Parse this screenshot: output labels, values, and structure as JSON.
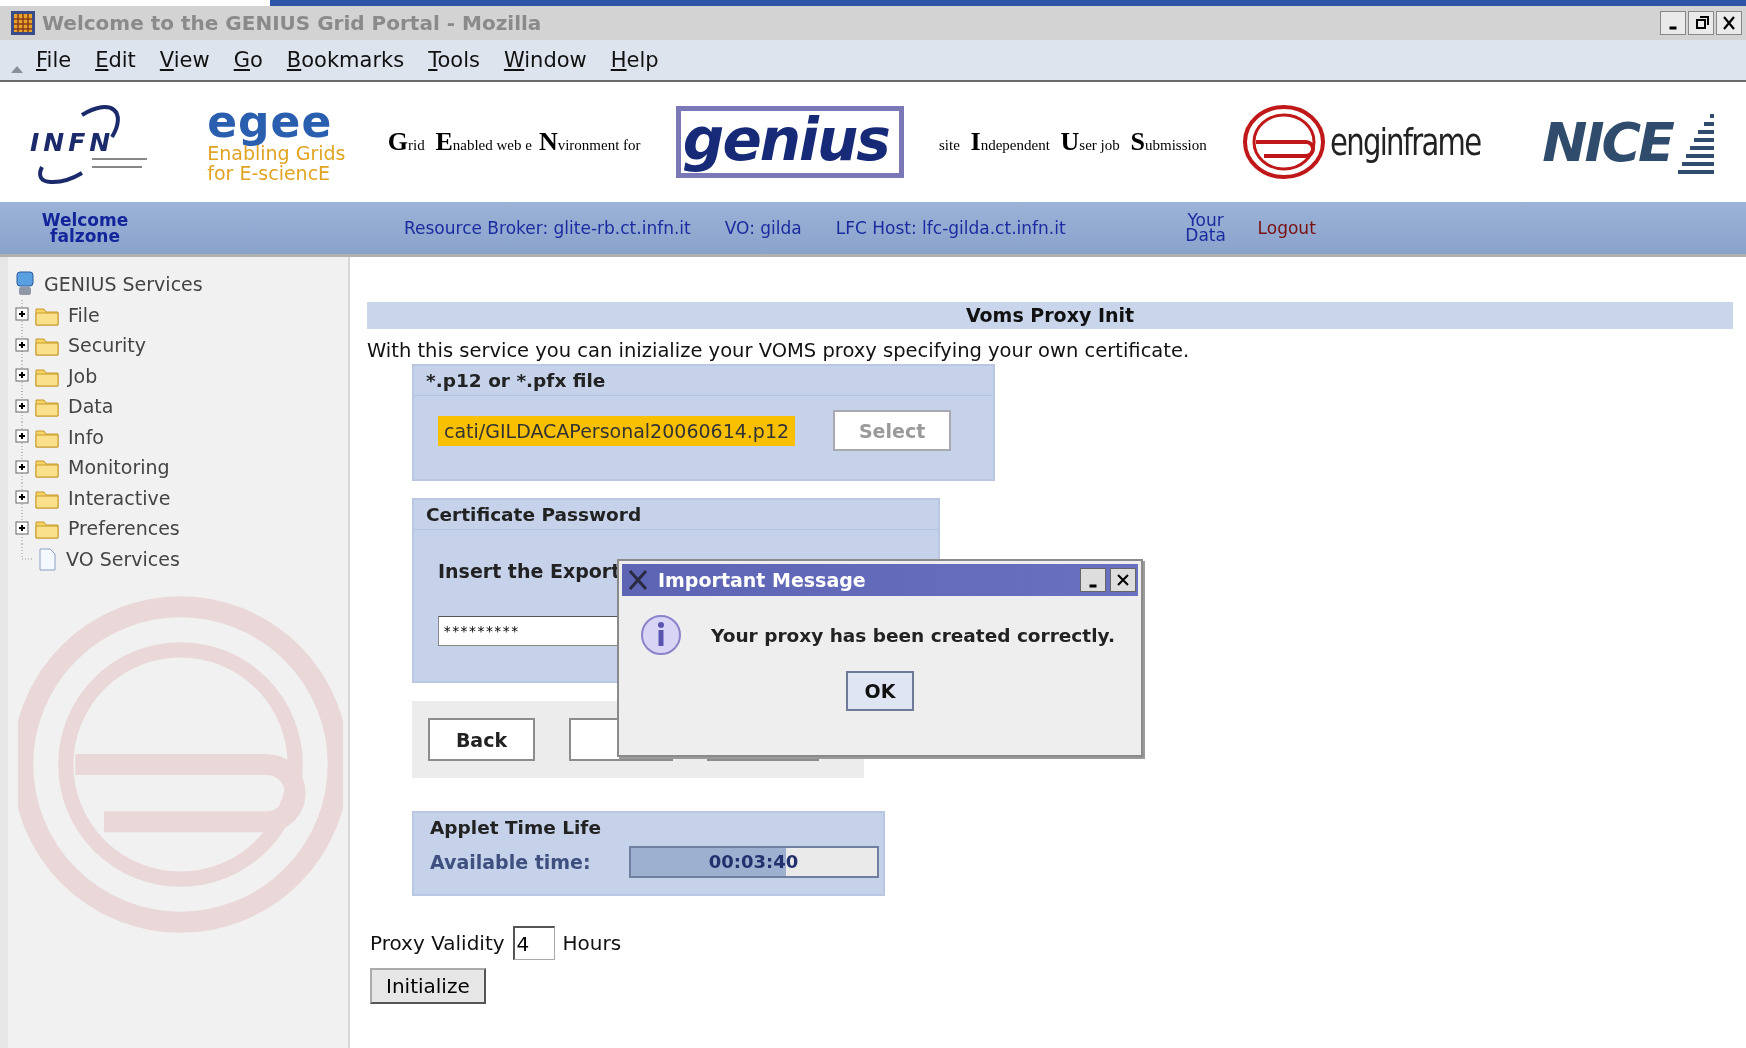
{
  "window": {
    "title": "Welcome to the GENIUS Grid Portal - Mozilla"
  },
  "menu": [
    "File",
    "Edit",
    "View",
    "Go",
    "Bookmarks",
    "Tools",
    "Window",
    "Help"
  ],
  "header": {
    "infn_logo": "INFN",
    "egee_logo": "egee",
    "egee_tagline_1": "Enabling Grids",
    "egee_tagline_2": "for E-sciencE",
    "genius_caption": "**G**rid **E**nabled web e**N**vironment for",
    "genius_logo": "genius",
    "site_caption": "site **I**ndependent **U**ser job **S**ubmission",
    "enginframe_logo": "enginframe",
    "nice_logo": "NICE"
  },
  "info_bar": {
    "welcome": "Welcome",
    "user": "falzone",
    "resource_broker": "Resource Broker: glite-rb.ct.infn.it",
    "vo": "VO: gilda",
    "lfc_host": "LFC Host: lfc-gilda.ct.infn.it",
    "links": [
      "Your Data",
      "Logout"
    ]
  },
  "sidebar": {
    "root": "GENIUS Services",
    "items": [
      {
        "label": "File",
        "kind": "folder",
        "expanded": false
      },
      {
        "label": "Security",
        "kind": "folder",
        "expanded": false
      },
      {
        "label": "Job",
        "kind": "folder",
        "expanded": false
      },
      {
        "label": "Data",
        "kind": "folder",
        "expanded": false
      },
      {
        "label": "Info",
        "kind": "folder",
        "expanded": false
      },
      {
        "label": "Monitoring",
        "kind": "folder",
        "expanded": false
      },
      {
        "label": "Interactive",
        "kind": "folder",
        "expanded": false
      },
      {
        "label": "Preferences",
        "kind": "folder",
        "expanded": false
      },
      {
        "label": "VO Services",
        "kind": "page"
      }
    ]
  },
  "main": {
    "title": "Voms Proxy Init",
    "intro": "With this service you can inizialize your VOMS proxy specifying your own certificate.",
    "file_panel": {
      "title": "*.p12 or *.pfx file",
      "value": "cati/GILDACAPersonal20060614.p12",
      "button": "Select"
    },
    "password_panel": {
      "title": "Certificate Password",
      "prompt": "Insert the Export",
      "value": "*********"
    },
    "buttons": [
      {
        "kind": "labeled",
        "label": "Back"
      },
      {
        "kind": "covered"
      },
      {
        "kind": "covered"
      }
    ],
    "time_panel": {
      "title": "Applet Time Life",
      "label": "Available time:",
      "reading": "00:03:40",
      "level": 0.63
    },
    "validity": {
      "label": "Proxy Validity",
      "value": "4",
      "unit": "Hours"
    },
    "initialize": "Initialize"
  },
  "dialog": {
    "title": "Important Message",
    "message": "Your proxy has been created correctly.",
    "button": "OK"
  }
}
